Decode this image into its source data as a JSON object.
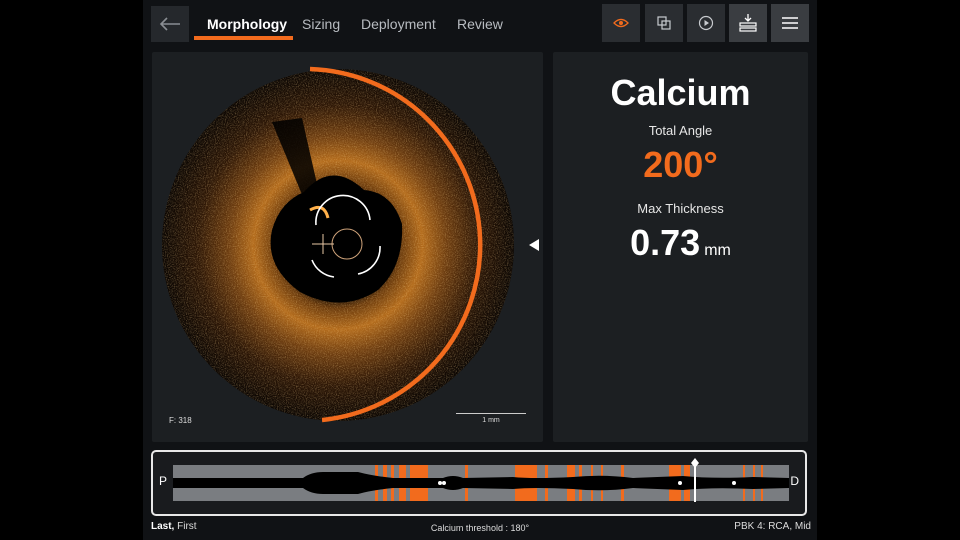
{
  "colors": {
    "accent": "#f26b1d",
    "panel": "#1c1f22",
    "background": "#101215"
  },
  "tabs": [
    {
      "label": "Morphology",
      "active": true
    },
    {
      "label": "Sizing",
      "active": false
    },
    {
      "label": "Deployment",
      "active": false
    },
    {
      "label": "Review",
      "active": false
    }
  ],
  "toolbar": {
    "icons": [
      "back-arrow-icon",
      "eye-icon",
      "layers-icon",
      "play-icon",
      "export-icon",
      "menu-icon"
    ]
  },
  "image": {
    "frame_label": "F: 318",
    "scale_label": "1 mm"
  },
  "measurement": {
    "title": "Calcium",
    "angle_label": "Total Angle",
    "angle_value": "200°",
    "thickness_label": "Max Thickness",
    "thickness_value": "0.73",
    "thickness_unit": "mm"
  },
  "longitudinal": {
    "proximal_label": "P",
    "distal_label": "D"
  },
  "footer": {
    "frame_order_bold": "Last,",
    "frame_order": "First",
    "threshold": "Calcium threshold : 180°",
    "vessel": "PBK 4:  RCA,  Mid"
  }
}
